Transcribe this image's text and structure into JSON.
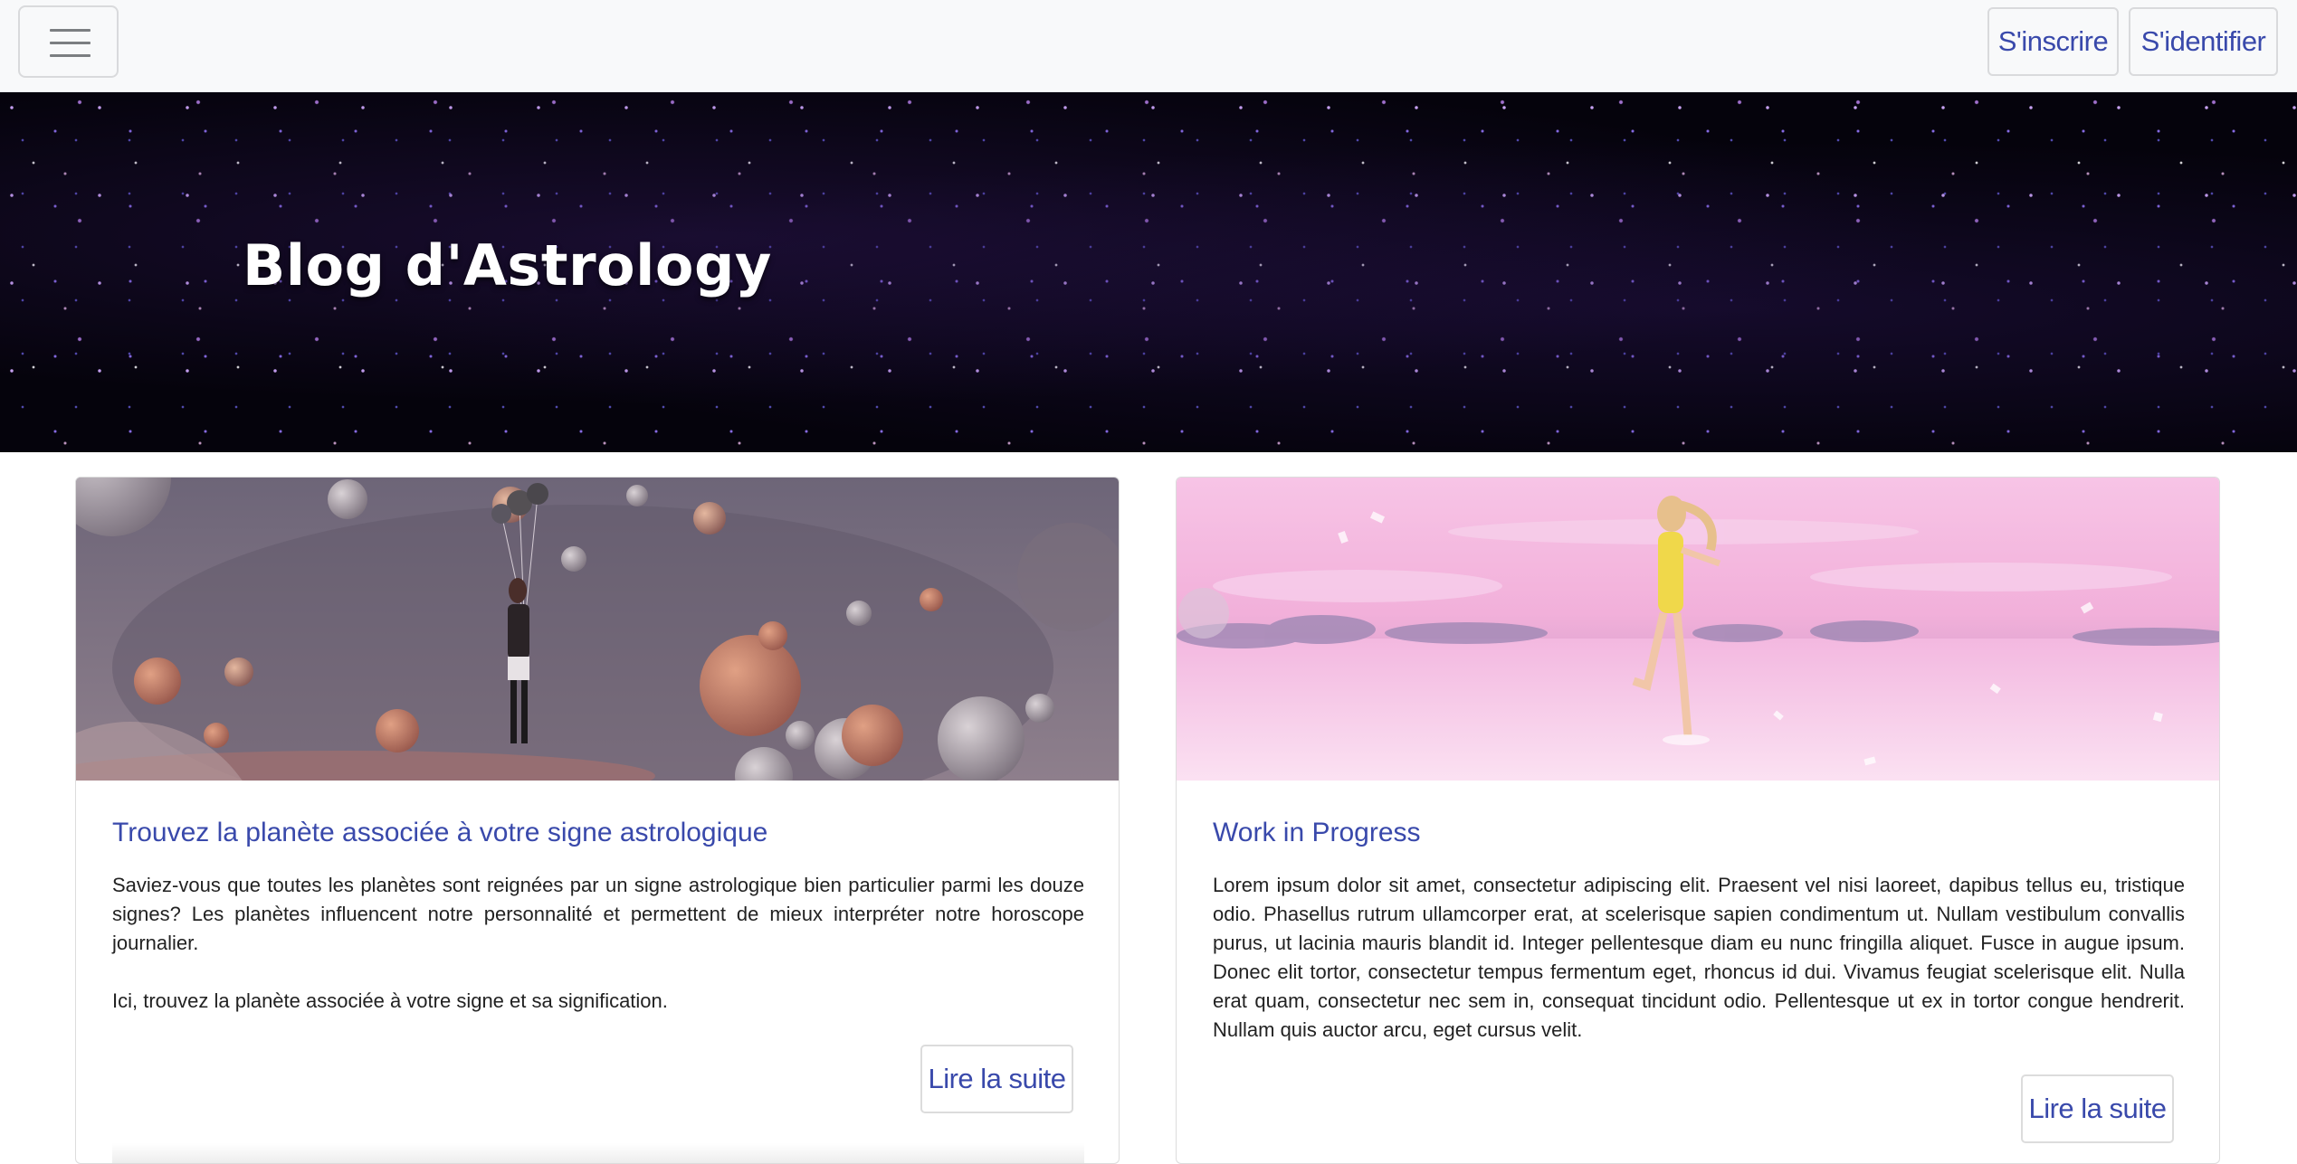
{
  "navbar": {
    "menu_icon": "hamburger-menu-icon",
    "signup_label": "S'inscrire",
    "login_label": "S'identifier",
    "accent_color": "#3949ab"
  },
  "hero": {
    "title": "Blog d'Astrology"
  },
  "cards": [
    {
      "image": "planets-and-woman-with-balloons",
      "title": "Trouvez la planète associée à votre signe astrologique",
      "paragraphs": [
        "Saviez-vous que toutes les planètes sont reignées par un signe astrologique bien particulier parmi les douze signes? Les planètes influencent notre personnalité et permettent de mieux interpréter notre horoscope journalier.",
        "Ici, trouvez la planète associée à votre signe et sa signification."
      ],
      "button_label": "Lire la suite"
    },
    {
      "image": "woman-jumping-pink-sky-over-water",
      "title": "Work in Progress",
      "paragraphs": [
        "Lorem ipsum dolor sit amet, consectetur adipiscing elit. Praesent vel nisi laoreet, dapibus tellus eu, tristique odio. Phasellus rutrum ullamcorper erat, at scelerisque sapien condimentum ut. Nullam vestibulum convallis purus, ut lacinia mauris blandit id. Integer pellentesque diam eu nunc fringilla aliquet. Fusce in augue ipsum. Donec elit tortor, consectetur tempus fermentum eget, rhoncus id dui. Vivamus feugiat scelerisque elit. Nulla erat quam, consectetur nec sem in, consequat tincidunt odio. Pellentesque ut ex in tortor congue hendrerit. Nullam quis auctor arcu, eget cursus velit."
      ],
      "button_label": "Lire la suite"
    }
  ]
}
